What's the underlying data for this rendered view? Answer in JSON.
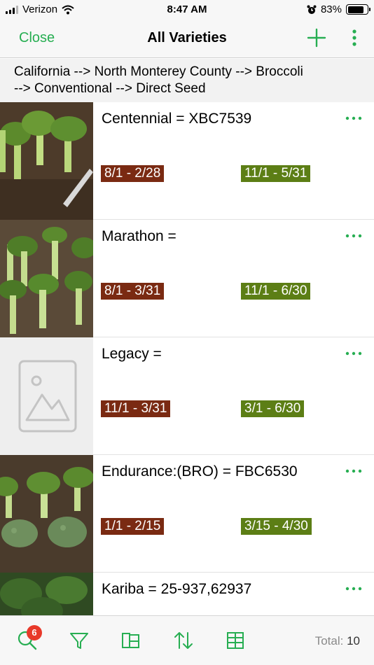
{
  "status_bar": {
    "carrier": "Verizon",
    "time": "8:47 AM",
    "battery": "83%",
    "battery_level": 0.83
  },
  "nav": {
    "close_label": "Close",
    "title": "All Varieties",
    "add_icon": "plus-icon",
    "more_icon": "vertical-ellipsis-icon"
  },
  "breadcrumb": {
    "line1": "California --> North Monterey County --> Broccoli",
    "line2": "--> Conventional --> Direct Seed"
  },
  "varieties": [
    {
      "name": "Centennial = XBC7539",
      "planting": "8/1 - 2/28",
      "harvest": "11/1 - 5/31",
      "image": "broccoli-photo"
    },
    {
      "name": "Marathon =",
      "planting": "8/1 - 3/31",
      "harvest": "11/1 - 6/30",
      "image": "broccoli-photo"
    },
    {
      "name": "Legacy =",
      "planting": "11/1 - 3/31",
      "harvest": "3/1 - 6/30",
      "image": "image-placeholder-icon"
    },
    {
      "name": "Endurance:(BRO) = FBC6530",
      "planting": "1/1 - 2/15",
      "harvest": "3/15 - 4/30",
      "image": "broccoli-photo"
    },
    {
      "name": "Kariba = 25-937,62937",
      "planting": "",
      "harvest": "",
      "image": "broccoli-photo"
    }
  ],
  "tab_bar": {
    "search_badge": "6",
    "total_label": "Total:",
    "total_value": "10"
  },
  "colors": {
    "accent": "#27ae52",
    "planting_badge": "#7a2a12",
    "harvest_badge": "#5c7e15",
    "notification_badge": "#e8392a"
  }
}
